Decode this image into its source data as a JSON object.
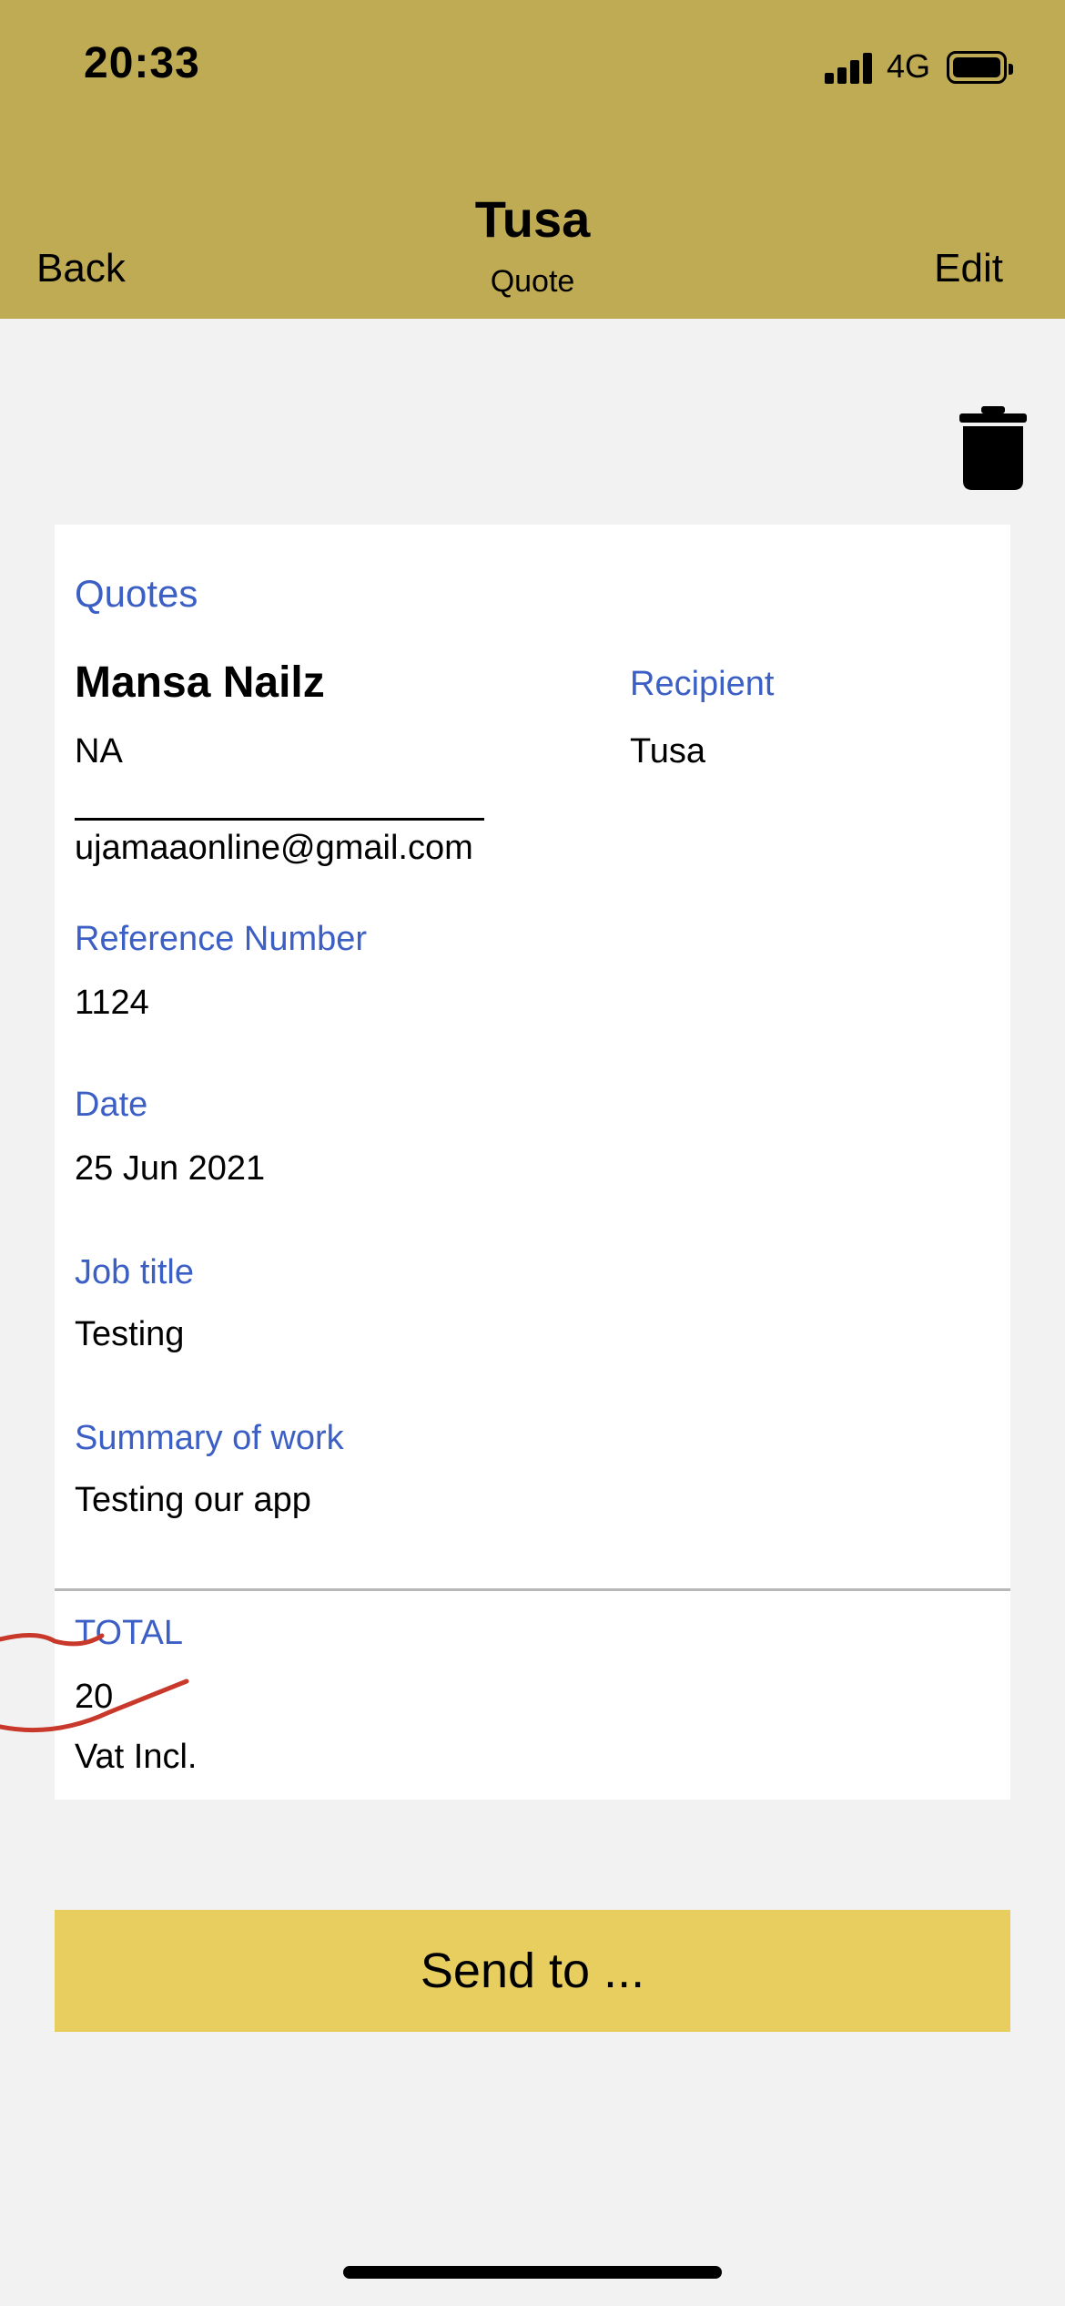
{
  "status_bar": {
    "time": "20:33",
    "network": "4G"
  },
  "nav": {
    "title": "Tusa",
    "subtitle": "Quote",
    "back_label": "Back",
    "edit_label": "Edit"
  },
  "quote": {
    "section_label": "Quotes",
    "sender_name": "Mansa Nailz",
    "sender_address": "NA",
    "sender_email": "ujamaaonline@gmail.com",
    "recipient_label": "Recipient",
    "recipient_value": "Tusa",
    "reference_label": "Reference Number",
    "reference_value": "1124",
    "date_label": "Date",
    "date_value": "25 Jun 2021",
    "job_title_label": "Job title",
    "job_title_value": "Testing",
    "summary_label": "Summary of work",
    "summary_value": "Testing our app",
    "total_label": "TOTAL",
    "total_value": "20",
    "vat_note": "Vat Incl."
  },
  "actions": {
    "send_label": "Send to ..."
  },
  "colors": {
    "header_bg": "#bfab54",
    "label_blue": "#3b5fc4",
    "button_yellow": "#e8ce5f",
    "annotation_red": "#c8392b"
  }
}
